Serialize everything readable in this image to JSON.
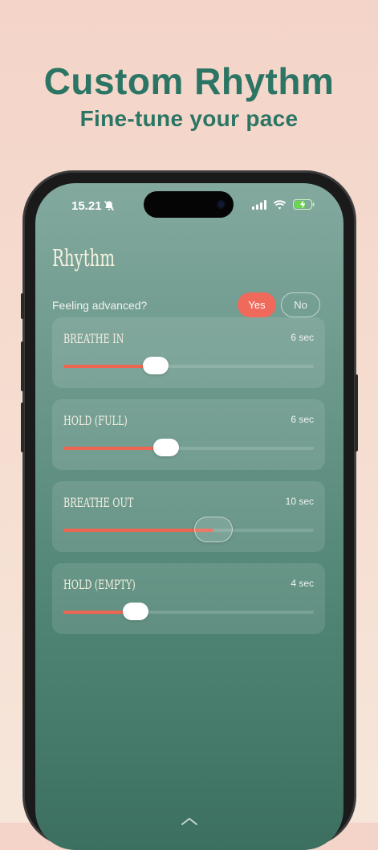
{
  "promo": {
    "title": "Custom Rhythm",
    "subtitle": "Fine-tune your pace"
  },
  "status_bar": {
    "time": "15.21",
    "icons": [
      "bell-slash-icon",
      "cellular-signal-icon",
      "wifi-icon",
      "battery-charging-icon"
    ]
  },
  "screen": {
    "title": "Rhythm",
    "advanced_question": "Feeling advanced?",
    "yes_label": "Yes",
    "no_label": "No",
    "selected_option": "Yes"
  },
  "sliders": [
    {
      "label": "BREATHE IN",
      "value_text": "6 sec",
      "level": 0.37
    },
    {
      "label": "HOLD (FULL)",
      "value_text": "6 sec",
      "level": 0.41
    },
    {
      "label": "BREATHE OUT",
      "value_text": "10 sec",
      "level": 0.6
    },
    {
      "label": "HOLD (EMPTY)",
      "value_text": "4 sec",
      "level": 0.29
    }
  ],
  "colors": {
    "accent": "#ee6651",
    "brand_text": "#2c7564",
    "screen_bg_top": "#83a99f",
    "screen_bg_bottom": "#3c6f5f"
  }
}
